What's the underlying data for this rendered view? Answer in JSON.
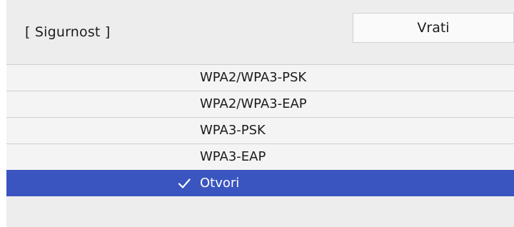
{
  "header": {
    "title": "[ Sigurnost ]",
    "back_label": "Vrati"
  },
  "list": {
    "items": [
      {
        "label": "WPA2/WPA3-PSK",
        "selected": false
      },
      {
        "label": "WPA2/WPA3-EAP",
        "selected": false
      },
      {
        "label": "WPA3-PSK",
        "selected": false
      },
      {
        "label": "WPA3-EAP",
        "selected": false
      },
      {
        "label": "Otvori",
        "selected": true
      }
    ]
  },
  "icons": {
    "selected_marker": "checkmark-icon"
  },
  "colors": {
    "selection": "#3a55c0",
    "panel": "#ededed",
    "row": "#f4f4f4",
    "divider": "#cfcfcf"
  }
}
